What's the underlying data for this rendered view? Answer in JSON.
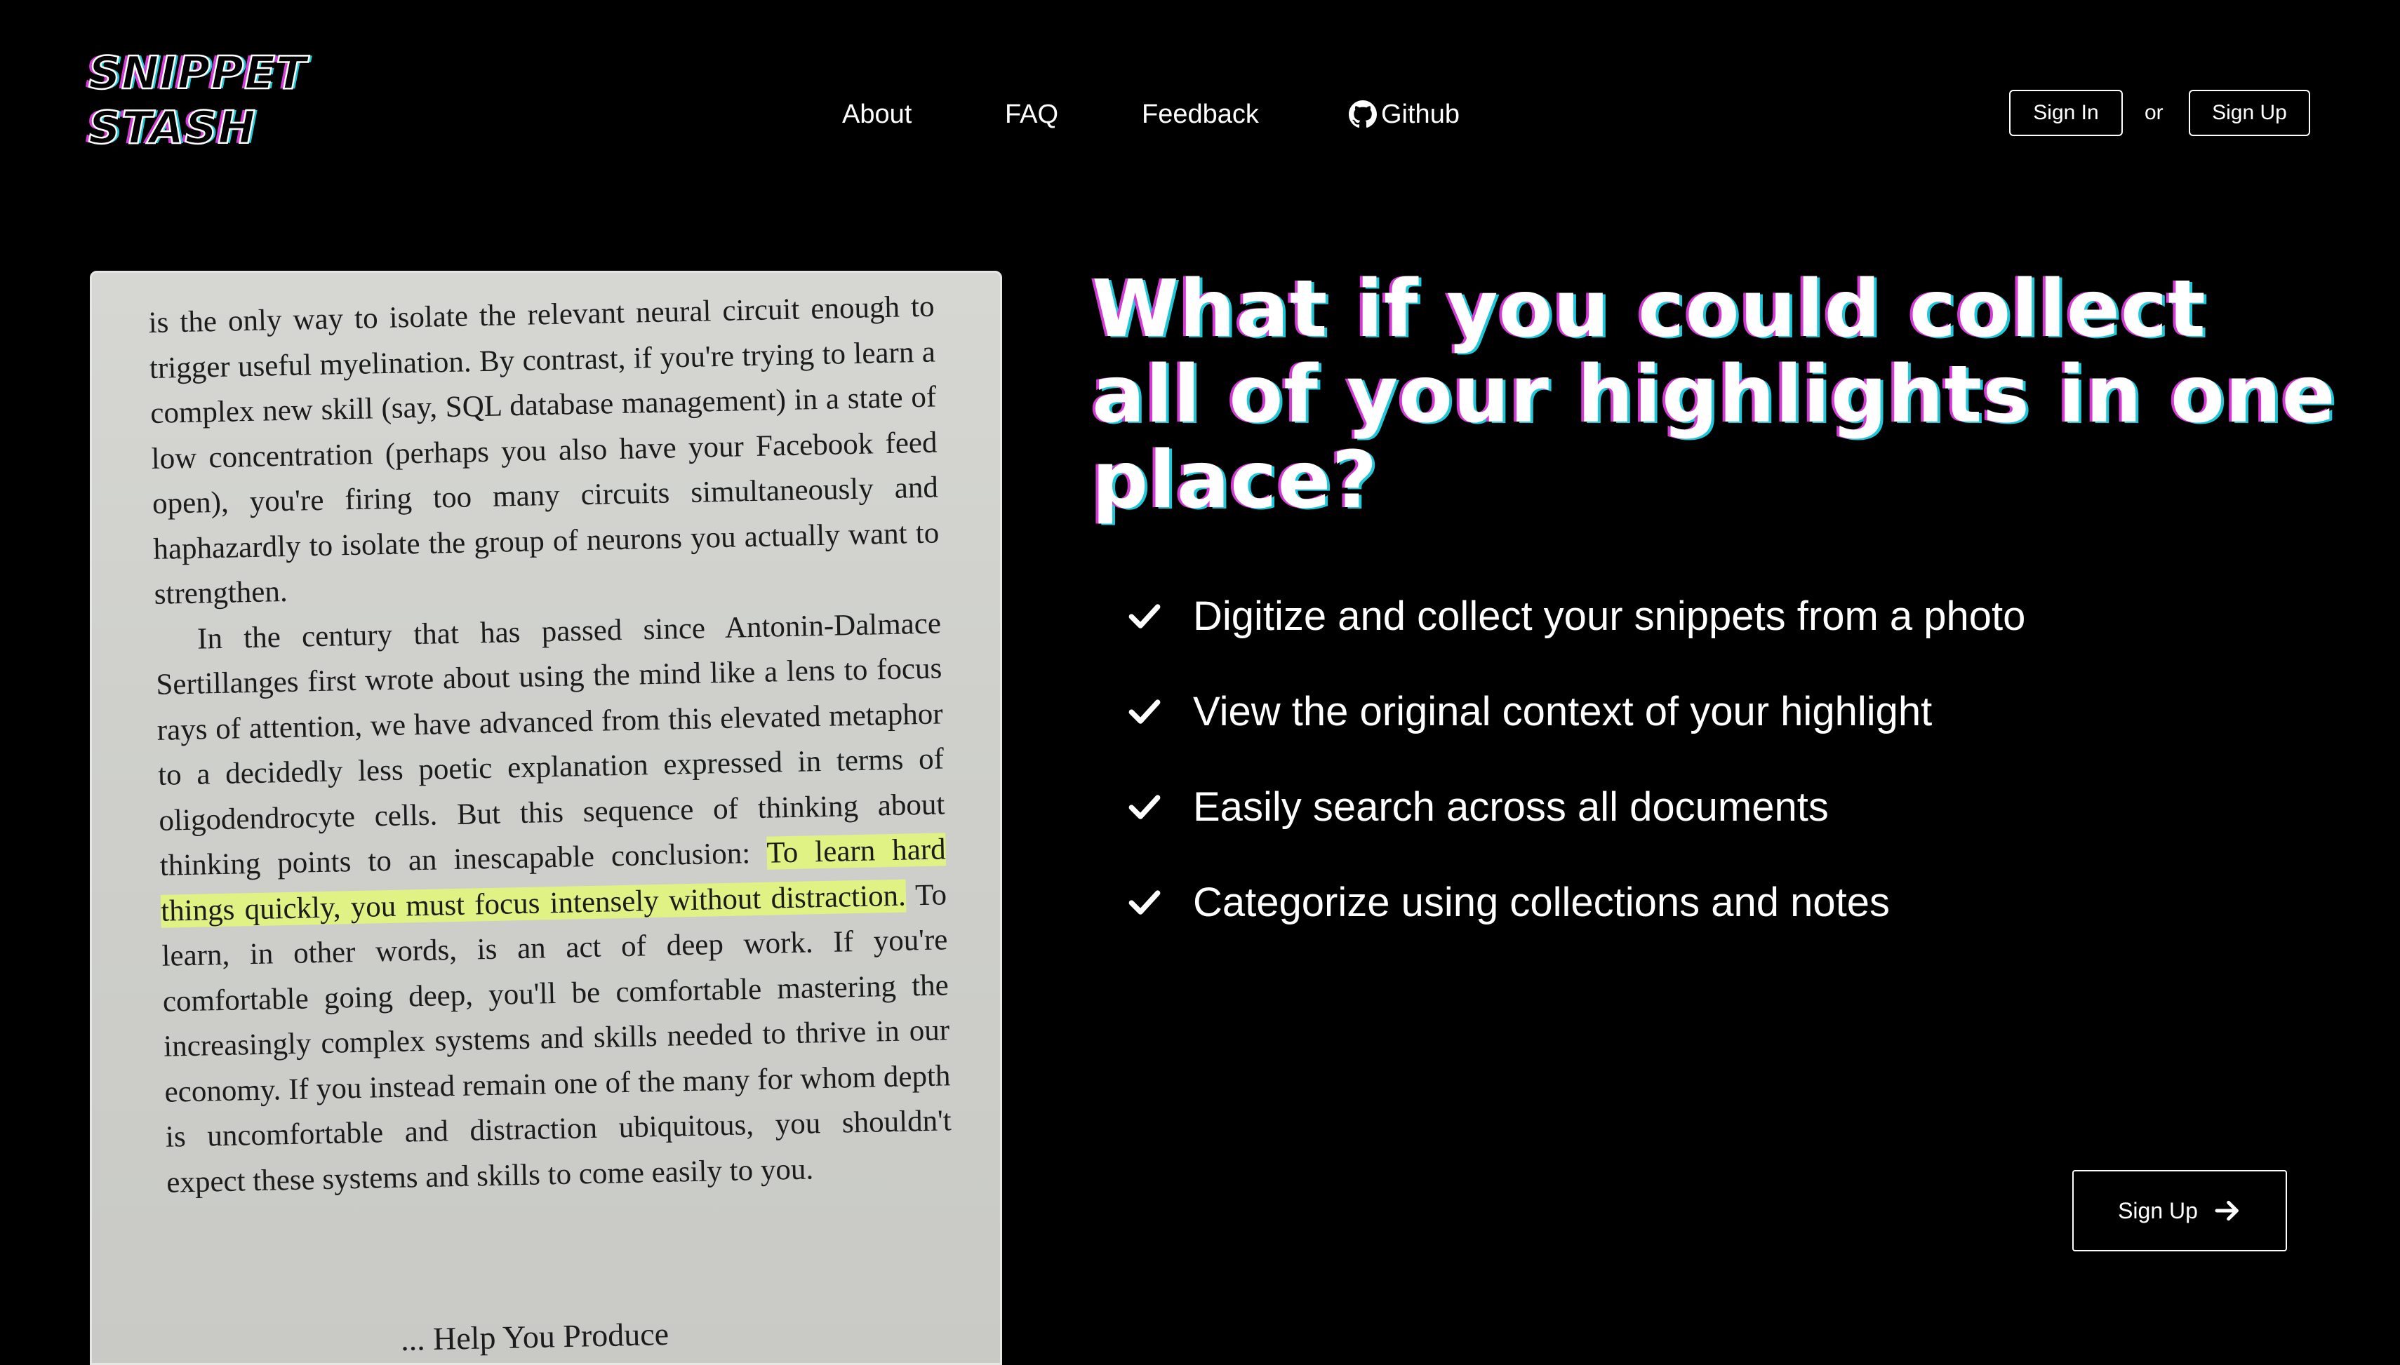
{
  "logo": {
    "line1": "SNIPPET",
    "line2": "STASH"
  },
  "nav": {
    "about": "About",
    "faq": "FAQ",
    "feedback": "Feedback",
    "github": "Github"
  },
  "auth": {
    "sign_in": "Sign In",
    "or": "or",
    "sign_up": "Sign Up"
  },
  "photo": {
    "paragraph1": "is the only way to isolate the relevant neural circuit enough to trigger useful myelination. By contrast, if you're trying to learn a complex new skill (say, SQL database management) in a state of low concentration (perhaps you also have your Facebook feed open), you're firing too many circuits simultaneously and haphazardly to isolate the group of neurons you actually want to strengthen.",
    "paragraph2_before": "In the century that has passed since Antonin-Dalmace Sertillanges first wrote about using the mind like a lens to focus rays of attention, we have advanced from this elevated metaphor to a decidedly less poetic explanation expressed in terms of oligodendrocyte cells. But this sequence of thinking about thinking points to an inescapable conclusion: ",
    "paragraph2_highlight": "To learn hard things quickly, you must focus intensely without distraction.",
    "paragraph2_after": " To learn, in other words, is an act of deep work. If you're comfortable going deep, you'll be comfortable mastering the increasingly complex systems and skills needed to thrive in our economy. If you instead remain one of the many for whom depth is uncomfortable and distraction ubiquitous, you shouldn't expect these systems and skills to come easily to you.",
    "footer_fragment": "... Help You Produce"
  },
  "headline": "What if you could collect all of your highlights in one place?",
  "features": [
    "Digitize and collect your snippets from a photo",
    "View the original context of your highlight",
    "Easily search across all documents",
    "Categorize using collections and notes"
  ],
  "cta": {
    "label": "Sign Up"
  },
  "colors": {
    "background": "#000000",
    "text": "#ffffff",
    "accent_magenta": "#d63ad6",
    "accent_cyan": "#1ec8d8",
    "highlight": "#e4f878"
  },
  "icons": {
    "github": "github-icon",
    "check": "check-icon",
    "arrow": "arrow-right-icon"
  }
}
